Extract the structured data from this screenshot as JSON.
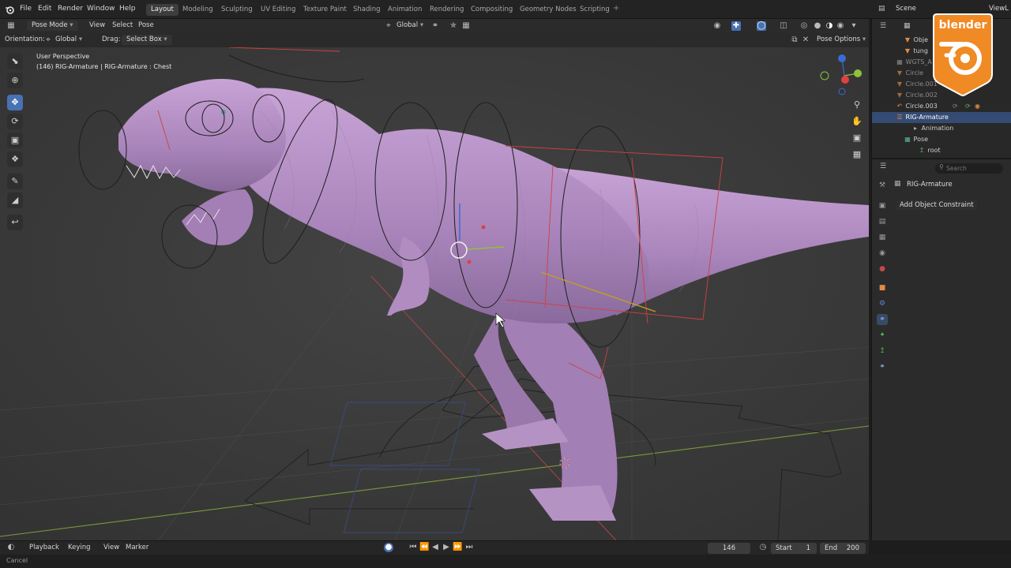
{
  "menu": [
    "File",
    "Edit",
    "Render",
    "Window",
    "Help"
  ],
  "workspaces": [
    {
      "label": "Layout",
      "active": true
    },
    {
      "label": "Modeling"
    },
    {
      "label": "Sculpting"
    },
    {
      "label": "UV Editing"
    },
    {
      "label": "Texture Paint"
    },
    {
      "label": "Shading"
    },
    {
      "label": "Animation"
    },
    {
      "label": "Rendering"
    },
    {
      "label": "Compositing"
    },
    {
      "label": "Geometry Nodes"
    },
    {
      "label": "Scripting"
    }
  ],
  "scene_label": "Scene",
  "view_layer_label": "ViewL",
  "header": {
    "mode": "Pose Mode",
    "menus": [
      "View",
      "Select",
      "Pose"
    ],
    "transform_orientation": "Global"
  },
  "tool_settings": {
    "orientation_label": "Orientation:",
    "orientation_value": "Global",
    "drag_label": "Drag:",
    "drag_value": "Select Box",
    "pose_options": "Pose Options"
  },
  "viewport": {
    "perspective": "User Perspective",
    "info": "(146) RIG-Armature | RIG-Armature : Chest"
  },
  "outliner": {
    "rows": [
      {
        "label": "Obje",
        "kind": "object",
        "state": "normal"
      },
      {
        "label": "tung",
        "kind": "object",
        "state": "normal"
      },
      {
        "label": "WGTS_A",
        "kind": "collection",
        "state": "dim"
      },
      {
        "label": "Circle",
        "kind": "curve",
        "state": "dim"
      },
      {
        "label": "Circle.001",
        "kind": "curve",
        "state": "dim"
      },
      {
        "label": "Circle.002",
        "kind": "curve",
        "state": "dim"
      },
      {
        "label": "Circle.003",
        "kind": "curve",
        "state": "normal"
      },
      {
        "label": "RIG-Armature",
        "kind": "armature",
        "state": "selected"
      },
      {
        "label": "Animation",
        "kind": "action",
        "state": "normal"
      },
      {
        "label": "Pose",
        "kind": "pose",
        "state": "normal"
      },
      {
        "label": "root",
        "kind": "bone",
        "state": "normal"
      }
    ]
  },
  "properties": {
    "search_placeholder": "Search",
    "object_name": "RIG-Armature",
    "add_constraint": "Add Object Constraint"
  },
  "timeline": {
    "menus": [
      "Playback",
      "Keying",
      "View",
      "Marker"
    ],
    "current_frame": "146",
    "start_label": "Start",
    "start_value": "1",
    "end_label": "End",
    "end_value": "200"
  },
  "status": {
    "left": "Cancel"
  },
  "logo_text": "blender",
  "colors": {
    "accent": "#4772b3",
    "dino": "#b48cc4",
    "logo": "#f08a24"
  }
}
